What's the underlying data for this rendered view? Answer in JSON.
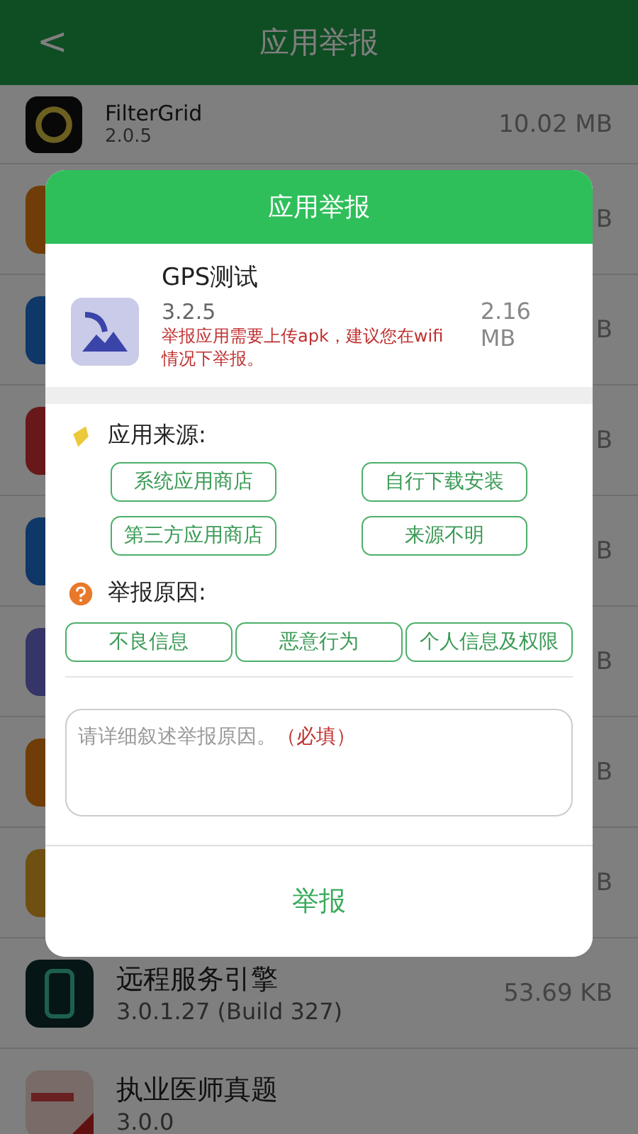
{
  "header": {
    "back": "<",
    "title": "应用举报"
  },
  "apps": [
    {
      "kind": "full",
      "name": "FilterGrid",
      "version": "2.0.5",
      "size": "10.02 MB"
    },
    {
      "kind": "hidden",
      "size": "B"
    },
    {
      "kind": "hidden",
      "size": "B"
    },
    {
      "kind": "hidden",
      "size": "B"
    },
    {
      "kind": "hidden",
      "size": "B"
    },
    {
      "kind": "hidden",
      "size": "B"
    },
    {
      "kind": "hidden",
      "size": "B"
    },
    {
      "kind": "hidden",
      "size": "B"
    },
    {
      "kind": "full",
      "name": "远程服务引擎",
      "version": "3.0.1.27 (Build 327)",
      "size": "53.69 KB"
    },
    {
      "kind": "full",
      "name": "执业医师真题",
      "version": "3.0.0"
    }
  ],
  "dialog": {
    "title": "应用举报",
    "app": {
      "name": "GPS测试",
      "version": "3.2.5",
      "size": "2.16 MB",
      "warning": "举报应用需要上传apk，建议您在wifi情况下举报。"
    },
    "source": {
      "label": "应用来源:",
      "options": [
        {
          "label": "系统应用商店",
          "selected": false
        },
        {
          "label": "自行下载安装",
          "selected": false
        },
        {
          "label": "第三方应用商店",
          "selected": false
        },
        {
          "label": "来源不明",
          "selected": false
        }
      ]
    },
    "reason": {
      "label": "举报原因:",
      "options": [
        {
          "label": "不良信息",
          "selected": false
        },
        {
          "label": "恶意行为",
          "selected": false
        },
        {
          "label": "个人信息及权限",
          "selected": false
        }
      ]
    },
    "description": {
      "placeholder": "请详细叙述举报原因。",
      "required_mark": "（必填）"
    },
    "submit": "举报"
  }
}
